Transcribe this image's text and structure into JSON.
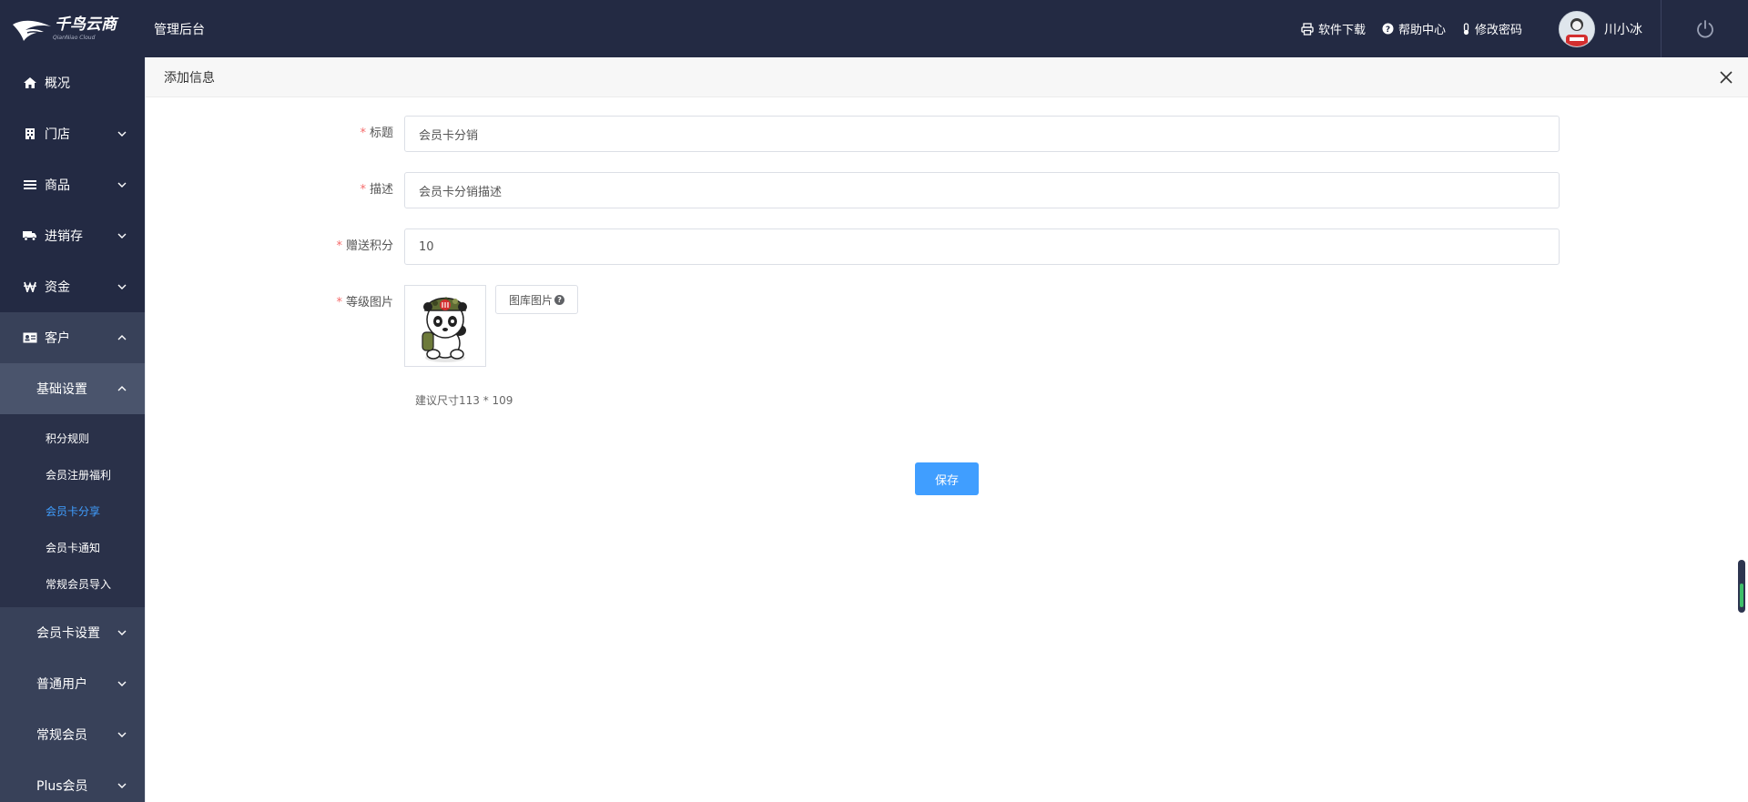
{
  "brand": {
    "name": "千鸟云商",
    "sub": "QianNiao Cloud"
  },
  "header": {
    "title": "管理后台",
    "links": [
      {
        "label": "软件下载",
        "icon": "printer-icon"
      },
      {
        "label": "帮助中心",
        "icon": "question-circle-icon"
      },
      {
        "label": "修改密码",
        "icon": "thermometer-icon"
      }
    ],
    "user_name": "川小冰"
  },
  "sidebar": {
    "items": [
      {
        "label": "概况",
        "icon": "home-icon"
      },
      {
        "label": "门店",
        "icon": "store-icon"
      },
      {
        "label": "商品",
        "icon": "list-icon"
      },
      {
        "label": "进销存",
        "icon": "truck-icon"
      },
      {
        "label": "资金",
        "icon": "won-icon"
      },
      {
        "label": "客户",
        "icon": "id-card-icon"
      }
    ],
    "customer_sub": [
      {
        "label": "基础设置"
      },
      {
        "label": "会员卡设置"
      },
      {
        "label": "普通用户"
      },
      {
        "label": "常规会员"
      },
      {
        "label": "Plus会员"
      }
    ],
    "basic_leaves": [
      "积分规则",
      "会员注册福利",
      "会员卡分享",
      "会员卡通知",
      "常规会员导入"
    ]
  },
  "panel": {
    "title": "添加信息",
    "fields": {
      "title_label": "标题",
      "title_value": "会员卡分销",
      "desc_label": "描述",
      "desc_value": "会员卡分销描述",
      "points_label": "赠送积分",
      "points_value": "10",
      "image_label": "等级图片"
    },
    "library_button": "图库图片",
    "help_mark": "?",
    "size_hint": "建议尺寸113 * 109",
    "save_label": "保存",
    "required_mark": "*"
  },
  "colors": {
    "nav_bg": "#232a43",
    "accent": "#409eff",
    "required": "#f56c6c"
  }
}
